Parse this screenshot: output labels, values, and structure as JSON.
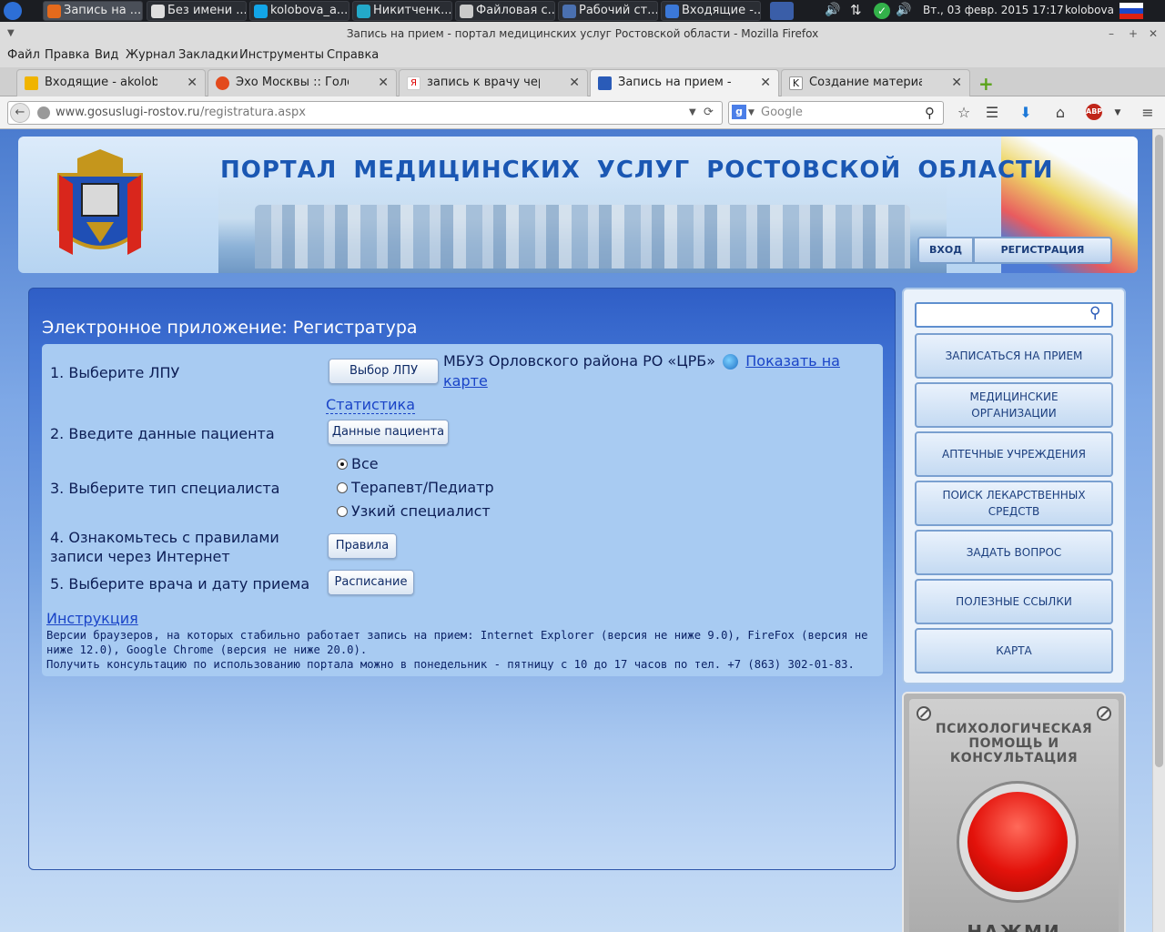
{
  "taskbar": {
    "tasks": [
      {
        "label": "Запись на ...",
        "icon": "firefox-icon",
        "active": true
      },
      {
        "label": "Без имени ...",
        "icon": "text-editor-icon"
      },
      {
        "label": "kolobova_a...",
        "icon": "skype-icon"
      },
      {
        "label": "Никитченк...",
        "icon": "chat-icon"
      },
      {
        "label": "Файловая с...",
        "icon": "file-manager-icon"
      },
      {
        "label": "Рабочий ст...",
        "icon": "remote-desktop-icon"
      },
      {
        "label": "Входящие -...",
        "icon": "mail-icon"
      }
    ],
    "clock": "Вт., 03 февр. 2015 17:17",
    "user": "kolobova"
  },
  "window": {
    "title": "Запись на прием - портал медицинских услуг Ростовской области - Mozilla Firefox"
  },
  "menubar": [
    "Файл",
    "Правка",
    "Вид",
    "Журнал",
    "Закладки",
    "Инструменты",
    "Справка"
  ],
  "tabs": [
    {
      "label": "Входящие - akolobova...",
      "icon": "mail-icon"
    },
    {
      "label": "Эхо Москвы :: Голосо...",
      "icon": "echo-icon"
    },
    {
      "label": "запись к врачу через ...",
      "icon": "yandex-icon"
    },
    {
      "label": "Запись на прием - пор...",
      "icon": "crest-icon",
      "active": true
    },
    {
      "label": "Создание материала Н...",
      "icon": "k-icon"
    }
  ],
  "navbar": {
    "url_domain": "www.gosuslugi-rostov.ru",
    "url_path": "/registratura.aspx",
    "search_placeholder": "Google"
  },
  "header": {
    "title": "ПОРТАЛ МЕДИЦИНСКИХ УСЛУГ РОСТОВСКОЙ ОБЛАСТИ",
    "login": "ВХОД",
    "register": "РЕГИСТРАЦИЯ"
  },
  "app": {
    "title": "Электронное приложение: Регистратура",
    "step1": "1. Выберите ЛПУ",
    "step1_button": "Выбор ЛПУ",
    "lpu_name": "МБУЗ Орловского района РО «ЦРБ»",
    "map_link": "Показать на карте",
    "stats_link": "Статистика",
    "step2": "2. Введите данные пациента",
    "step2_button": "Данные пациента",
    "step3": "3. Выберите тип специалиста",
    "specialists": [
      {
        "label": "Все",
        "checked": true
      },
      {
        "label": "Терапевт/Педиатр",
        "checked": false
      },
      {
        "label": "Узкий специалист",
        "checked": false
      }
    ],
    "step4": "4. Ознакомьтесь с правилами записи через Интернет",
    "step4_button": "Правила",
    "step5": "5. Выберите врача и дату приема",
    "step5_button": "Расписание",
    "instructions_link": "Инструкция",
    "browsers_note": "Версии браузеров, на которых стабильно работает запись на прием: Internet Explorer (версия не ниже 9.0), FireFox (версия не ниже 12.0), Google Chrome (версия не ниже 20.0).",
    "consult_note": "Получить консультацию по использованию портала можно в понедельник - пятницу с 10 до 17 часов по тел. +7 (863) 302-01-83."
  },
  "sidebar": {
    "items": [
      "ЗАПИСАТЬСЯ НА ПРИЕМ",
      "МЕДИЦИНСКИЕ ОРГАНИЗАЦИИ",
      "АПТЕЧНЫЕ УЧРЕЖДЕНИЯ",
      "ПОИСК ЛЕКАРСТВЕННЫХ СРЕДСТВ",
      "ЗАДАТЬ ВОПРОС",
      "ПОЛЕЗНЫЕ ССЫЛКИ",
      "КАРТА"
    ]
  },
  "panic": {
    "text": "ПСИХОЛОГИЧЕСКАЯ ПОМОЩЬ И КОНСУЛЬТАЦИЯ",
    "press": "НАЖМИ"
  },
  "colors": {
    "accent": "#1a57b3",
    "link": "#1a44c7",
    "panic_red": "#e3120b"
  }
}
